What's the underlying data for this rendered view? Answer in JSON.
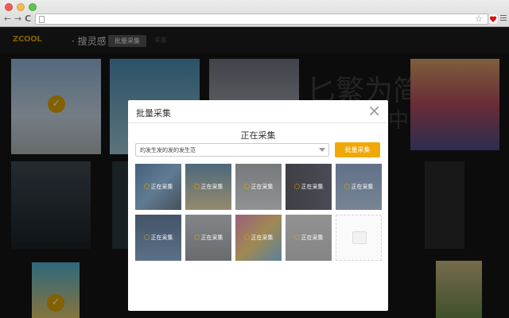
{
  "browser": {
    "nav_back": "←",
    "nav_forward": "→",
    "nav_reload": "C",
    "star": "☆",
    "icons": [
      "page-icon",
      "star-icon",
      "extension-heart-icon",
      "menu-icon"
    ]
  },
  "site": {
    "logo": "ZCOOL",
    "logo_sub": "· 搜灵感",
    "header_button": "批量采集",
    "header_link": "采集",
    "bg_text_1": "匕繁为简",
    "bg_text_2": "中"
  },
  "modal": {
    "title": "批量采集",
    "status": "正在采集",
    "select_value": "的发生发的发的发生范",
    "collect_button": "批量采集",
    "thumb_label": "正在采集",
    "thumbnails": [
      {
        "status": "正在采集"
      },
      {
        "status": "正在采集"
      },
      {
        "status": "正在采集"
      },
      {
        "status": "正在采集"
      },
      {
        "status": "正在采集"
      },
      {
        "status": "正在采集"
      },
      {
        "status": "正在采集"
      },
      {
        "status": "正在采集"
      },
      {
        "status": "正在采集"
      },
      {
        "status": ""
      }
    ]
  },
  "colors": {
    "accent": "#f0a808",
    "overlay": "#000000"
  }
}
